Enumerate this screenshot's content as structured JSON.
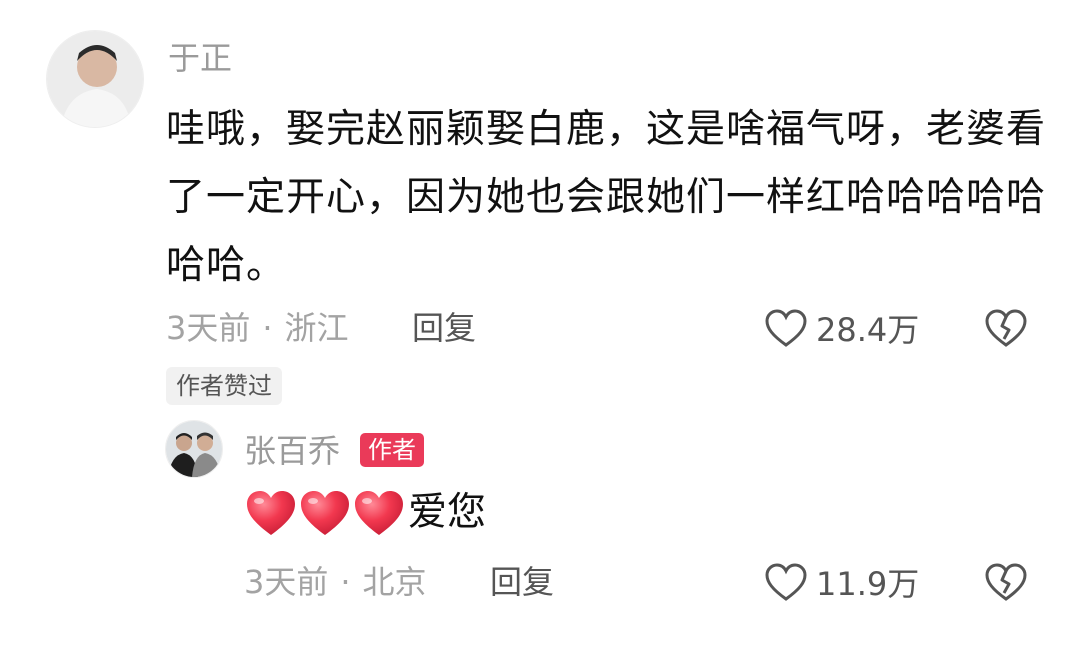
{
  "comment": {
    "author": "于正",
    "text": "哇哦，娶完赵丽颖娶白鹿，这是啥福气呀，老婆看了一定开心，因为她也会跟她们一样红哈哈哈哈哈哈哈。",
    "time": "3天前",
    "location": "浙江",
    "reply_label": "回复",
    "likes": "28.4万",
    "author_liked_tag": "作者赞过"
  },
  "reply": {
    "author": "张百乔",
    "author_badge": "作者",
    "text": "爱您",
    "emoji": [
      "red-heart",
      "red-heart",
      "red-heart"
    ],
    "time": "3天前",
    "location": "北京",
    "reply_label": "回复",
    "likes": "11.9万"
  },
  "separator": "·",
  "colors": {
    "badge": "#ea3a59",
    "meta_text": "#a3a3a3",
    "heart_red": "#f2384f"
  }
}
